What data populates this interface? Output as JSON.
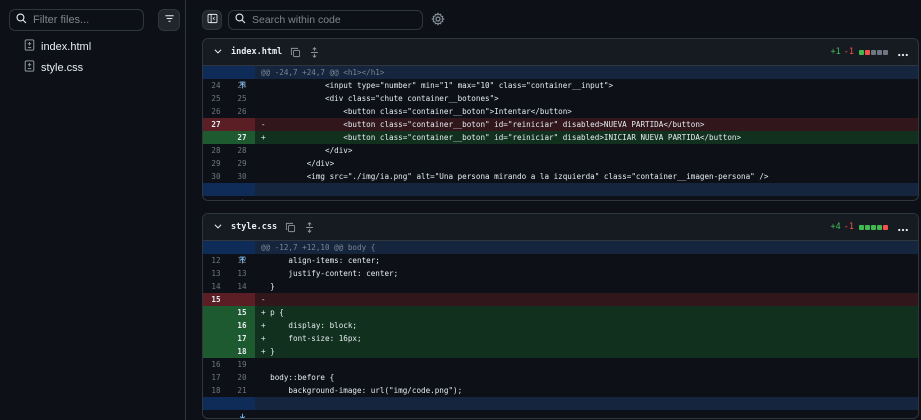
{
  "sidebar": {
    "filter_placeholder": "Filter files...",
    "files": [
      {
        "name": "index.html",
        "icon": "file-diff-icon"
      },
      {
        "name": "style.css",
        "icon": "file-diff-icon"
      }
    ]
  },
  "toolbar": {
    "search_placeholder": "Search within code"
  },
  "colors": {
    "addition": "#3fb950",
    "deletion": "#f85149",
    "hunk_bg": "#14253d",
    "bg": "#0d1117"
  },
  "diffs": [
    {
      "file": "index.html",
      "additions": "+1",
      "deletions": "-1",
      "stat_blocks": [
        "add",
        "del",
        "neutral",
        "neutral",
        "neutral"
      ],
      "hunk": "@@ -24,7 +24,7 @@ <h1></h1>",
      "lines": [
        {
          "l": "24",
          "r": "24",
          "type": "ctx",
          "code": "              <input type=\"number\" min=\"1\" max=\"10\" class=\"container__input\">"
        },
        {
          "l": "25",
          "r": "25",
          "type": "ctx",
          "code": "              <div class=\"chute container__botones\">"
        },
        {
          "l": "26",
          "r": "26",
          "type": "ctx",
          "code": "                  <button class=\"container__boton\">Intentar</button>"
        },
        {
          "l": "27",
          "r": "",
          "type": "del",
          "code": "-                 <button class=\"container__boton\" id=\"reiniciar\" disabled>NUEVA PARTIDA</button>"
        },
        {
          "l": "",
          "r": "27",
          "type": "add",
          "code": "+                 <button class=\"container__boton\" id=\"reiniciar\" disabled>INICIAR NUEVA PARTIDA</button>"
        },
        {
          "l": "28",
          "r": "28",
          "type": "ctx",
          "code": "              </div>"
        },
        {
          "l": "29",
          "r": "29",
          "type": "ctx",
          "code": "          </div>"
        },
        {
          "l": "30",
          "r": "30",
          "type": "ctx",
          "code": "          <img src=\"./img/ia.png\" alt=\"Una persona mirando a la izquierda\" class=\"container__imagen-persona\" />"
        }
      ]
    },
    {
      "file": "style.css",
      "additions": "+4",
      "deletions": "-1",
      "stat_blocks": [
        "add",
        "add",
        "add",
        "add",
        "del"
      ],
      "hunk": "@@ -12,7 +12,10 @@ body {",
      "lines": [
        {
          "l": "12",
          "r": "12",
          "type": "ctx",
          "code": "      align-items: center;"
        },
        {
          "l": "13",
          "r": "13",
          "type": "ctx",
          "code": "      justify-content: center;"
        },
        {
          "l": "14",
          "r": "14",
          "type": "ctx",
          "code": "  }"
        },
        {
          "l": "15",
          "r": "",
          "type": "del",
          "code": "-"
        },
        {
          "l": "",
          "r": "15",
          "type": "add",
          "code": "+ p {"
        },
        {
          "l": "",
          "r": "16",
          "type": "add",
          "code": "+     display: block;"
        },
        {
          "l": "",
          "r": "17",
          "type": "add",
          "code": "+     font-size: 16px;"
        },
        {
          "l": "",
          "r": "18",
          "type": "add",
          "code": "+ }"
        },
        {
          "l": "16",
          "r": "19",
          "type": "ctx",
          "code": ""
        },
        {
          "l": "17",
          "r": "20",
          "type": "ctx",
          "code": "  body::before {"
        },
        {
          "l": "18",
          "r": "21",
          "type": "ctx",
          "code": "      background-image: url(\"img/code.png\");"
        }
      ]
    }
  ]
}
